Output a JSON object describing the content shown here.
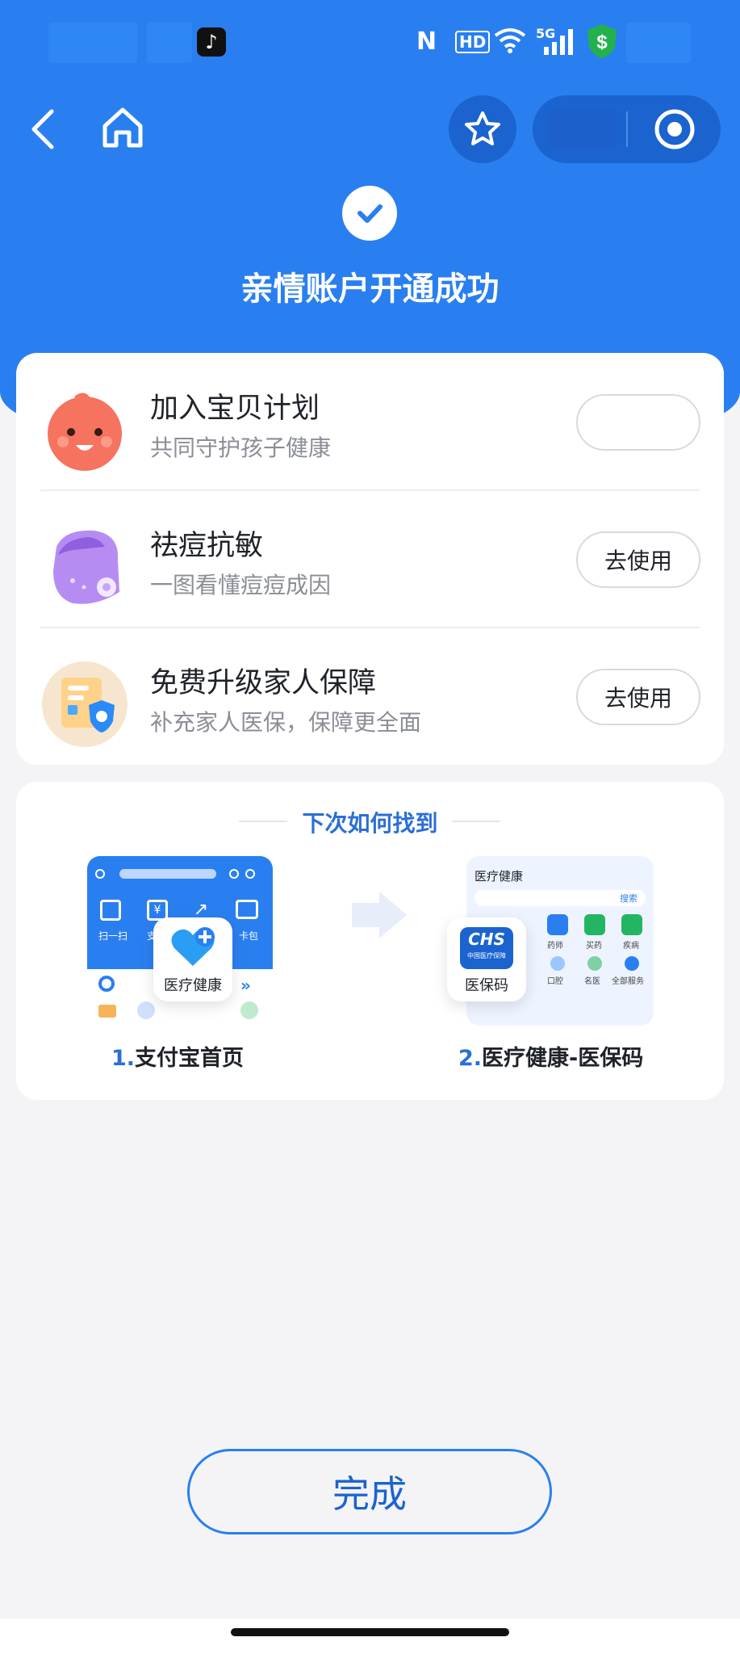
{
  "header": {
    "title": "亲情账户开通成功"
  },
  "status_bar": {
    "hd": "HD",
    "net": "5G"
  },
  "services": [
    {
      "name": "加入宝贝计划",
      "desc": "共同守护孩子健康",
      "action": ""
    },
    {
      "name": "祛痘抗敏",
      "desc": "一图看懂痘痘成因",
      "action": "去使用"
    },
    {
      "name": "免费升级家人保障",
      "desc": "补充家人医保，保障更全面",
      "action": "去使用"
    }
  ],
  "find": {
    "title": "下次如何找到",
    "step1_num": "1.",
    "step1_label": "支付宝首页",
    "step2_num": "2.",
    "step2_label": "医疗健康-医保码",
    "chip1_label": "医疗健康",
    "chip2_label": "医保码",
    "mock2_title": "医疗健康",
    "mock2_search": "搜索",
    "mock1_icons": [
      "扫一扫",
      "支付",
      "",
      "卡包"
    ],
    "mock2_icons": [
      "药师",
      "买药",
      "疾病",
      "口腔",
      "名医",
      "全部服务"
    ],
    "chip2_logo": "CHS",
    "chip2_sub": "中国医疗保障"
  },
  "done_button": "完成",
  "colors": {
    "brand_blue": "#2a7ff0",
    "dark_blue": "#1b63cf",
    "accent_text": "#2a6fd6"
  }
}
